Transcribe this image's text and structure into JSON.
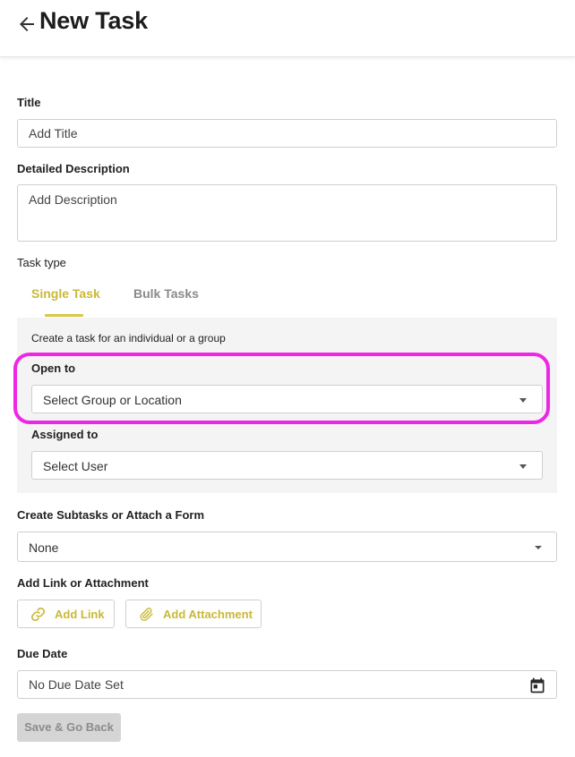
{
  "header": {
    "title": "New Task",
    "back_icon": "arrow-left-icon"
  },
  "form": {
    "title_label": "Title",
    "title_placeholder": "Add Title",
    "description_label": "Detailed Description",
    "description_placeholder": "Add Description",
    "task_type_label": "Task type",
    "tabs": [
      {
        "label": "Single Task",
        "active": true
      },
      {
        "label": "Bulk Tasks",
        "active": false
      }
    ],
    "panel": {
      "description": "Create a task for an individual or a group",
      "open_to_label": "Open to",
      "open_to_value": "Select Group or Location",
      "assigned_to_label": "Assigned to",
      "assigned_to_value": "Select User"
    },
    "subtasks_label": "Create Subtasks or Attach a Form",
    "subtasks_value": "None",
    "link_label": "Add Link or Attachment",
    "add_link_label": "Add Link",
    "add_attachment_label": "Add Attachment",
    "due_date_label": "Due Date",
    "due_date_value": "No Due Date Set",
    "save_label": "Save & Go Back"
  },
  "colors": {
    "accent": "#c9b83a",
    "highlight": "#f026e6",
    "panel_bg": "#f4f4f4",
    "disabled_bg": "#d5d5d5"
  },
  "icons": {
    "link": "link-icon",
    "attachment": "paperclip-icon",
    "calendar": "calendar-icon",
    "dropdown": "caret-down-icon"
  }
}
